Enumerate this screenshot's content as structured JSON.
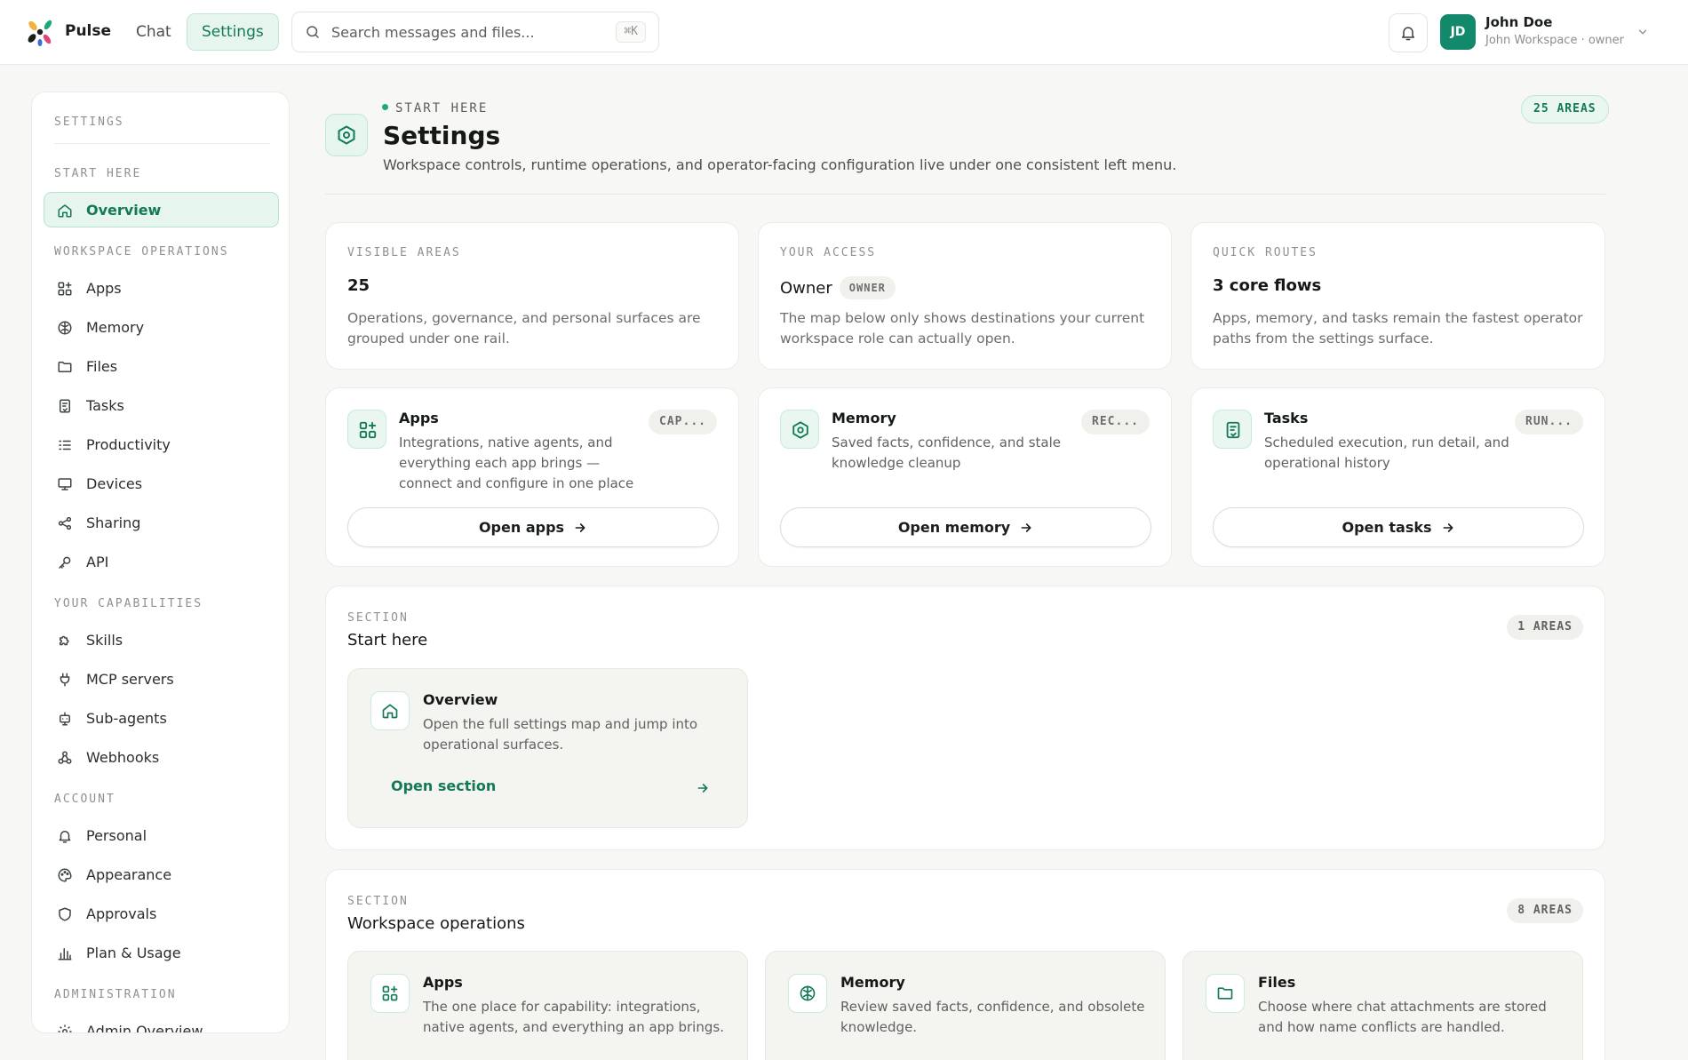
{
  "app": {
    "brand": "Pulse",
    "colors": {
      "accent": "#127a57",
      "accent_soft": "#e6f6ef",
      "avatar": "#12896a"
    }
  },
  "topbar": {
    "nav": [
      {
        "label": "Chat",
        "active": false
      },
      {
        "label": "Settings",
        "active": true
      }
    ],
    "search": {
      "placeholder": "Search messages and files...",
      "shortcut": "⌘K"
    },
    "user": {
      "initials": "JD",
      "name": "John Doe",
      "subtitle": "John Workspace · owner"
    }
  },
  "sidebar": {
    "title": "SETTINGS",
    "groups": [
      {
        "label": "START HERE",
        "items": [
          {
            "label": "Overview",
            "icon": "home-icon",
            "active": true
          }
        ]
      },
      {
        "label": "WORKSPACE OPERATIONS",
        "items": [
          {
            "label": "Apps",
            "icon": "apps-grid-icon"
          },
          {
            "label": "Memory",
            "icon": "brain-icon"
          },
          {
            "label": "Files",
            "icon": "folder-icon"
          },
          {
            "label": "Tasks",
            "icon": "clipboard-icon"
          },
          {
            "label": "Productivity",
            "icon": "list-checks-icon"
          },
          {
            "label": "Devices",
            "icon": "monitor-icon"
          },
          {
            "label": "Sharing",
            "icon": "share-icon"
          },
          {
            "label": "API",
            "icon": "key-icon"
          }
        ]
      },
      {
        "label": "YOUR CAPABILITIES",
        "items": [
          {
            "label": "Skills",
            "icon": "puzzle-icon"
          },
          {
            "label": "MCP servers",
            "icon": "plug-icon"
          },
          {
            "label": "Sub-agents",
            "icon": "bot-icon"
          },
          {
            "label": "Webhooks",
            "icon": "webhook-icon"
          }
        ]
      },
      {
        "label": "ACCOUNT",
        "items": [
          {
            "label": "Personal",
            "icon": "bell-icon"
          },
          {
            "label": "Appearance",
            "icon": "palette-icon"
          },
          {
            "label": "Approvals",
            "icon": "shield-icon"
          },
          {
            "label": "Plan & Usage",
            "icon": "bar-chart-icon"
          }
        ]
      },
      {
        "label": "ADMINISTRATION",
        "items": [
          {
            "label": "Admin Overview",
            "icon": "gear-icon"
          }
        ]
      }
    ]
  },
  "header": {
    "eyebrow": "START HERE",
    "title": "Settings",
    "description": "Workspace controls, runtime operations, and operator-facing configuration live under one consistent left menu.",
    "badge": "25 AREAS"
  },
  "stats": [
    {
      "label": "VISIBLE AREAS",
      "value": "25",
      "description": "Operations, governance, and personal surfaces are grouped under one rail."
    },
    {
      "label": "YOUR ACCESS",
      "value": "Owner",
      "pill": "OWNER",
      "description": "The map below only shows destinations your current workspace role can actually open."
    },
    {
      "label": "QUICK ROUTES",
      "value": "3 core flows",
      "description": "Apps, memory, and tasks remain the fastest operator paths from the settings surface."
    }
  ],
  "quick_routes": [
    {
      "title": "Apps",
      "pill": "CAP...",
      "description": "Integrations, native agents, and everything each app brings — connect and configure in one place",
      "button": "Open apps",
      "icon": "apps-grid-icon"
    },
    {
      "title": "Memory",
      "pill": "REC...",
      "description": "Saved facts, confidence, and stale knowledge cleanup",
      "button": "Open memory",
      "icon": "hexagon-icon"
    },
    {
      "title": "Tasks",
      "pill": "RUN...",
      "description": "Scheduled execution, run detail, and operational history",
      "button": "Open tasks",
      "icon": "clipboard-icon"
    }
  ],
  "sections": [
    {
      "eyebrow": "SECTION",
      "title": "Start here",
      "badge": "1 AREAS",
      "tiles": [
        {
          "title": "Overview",
          "description": "Open the full settings map and jump into operational surfaces.",
          "link": "Open section",
          "icon": "home-icon"
        }
      ]
    },
    {
      "eyebrow": "SECTION",
      "title": "Workspace operations",
      "badge": "8 AREAS",
      "tiles": [
        {
          "title": "Apps",
          "description": "The one place for capability: integrations, native agents, and everything an app brings.",
          "icon": "apps-grid-icon"
        },
        {
          "title": "Memory",
          "description": "Review saved facts, confidence, and obsolete knowledge.",
          "icon": "brain-icon"
        },
        {
          "title": "Files",
          "description": "Choose where chat attachments are stored and how name conflicts are handled.",
          "icon": "folder-icon"
        }
      ]
    }
  ]
}
